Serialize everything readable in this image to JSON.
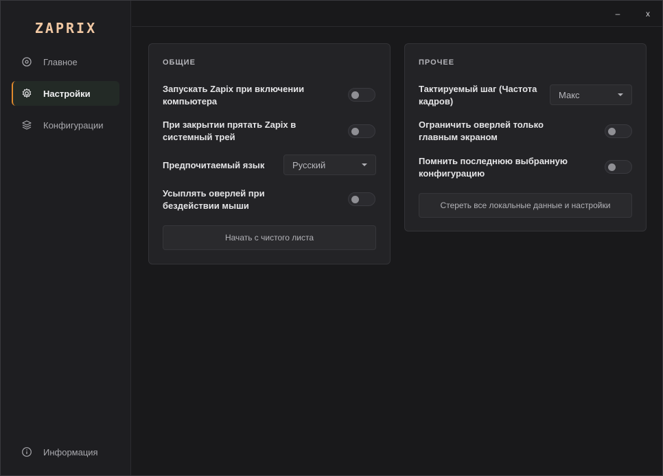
{
  "app": {
    "logo": "ZAPRIX"
  },
  "window_controls": {
    "minimize": "–",
    "close": "x"
  },
  "sidebar": {
    "items": [
      {
        "label": "Главное",
        "icon": "crosshair-icon"
      },
      {
        "label": "Настройки",
        "icon": "gear-icon",
        "active": true
      },
      {
        "label": "Конфигурации",
        "icon": "layers-icon"
      }
    ],
    "footer": {
      "label": "Информация",
      "icon": "info-icon"
    }
  },
  "general": {
    "title": "ОБЩИЕ",
    "autostart_label": "Запускать Zapix при включении компьютера",
    "autostart_on": false,
    "tray_label": "При закрытии прятать Zapix в системный трей",
    "tray_on": false,
    "language_label": "Предпочитаемый язык",
    "language_value": "Русский",
    "sleep_label": "Усыплять оверлей при бездействии мыши",
    "sleep_on": false,
    "reset_button": "Начать с чистого листа"
  },
  "other": {
    "title": "ПРОЧЕЕ",
    "tick_label": "Тактируемый шаг (Частота кадров)",
    "tick_value": "Макс",
    "main_screen_label": "Ограничить оверлей только главным экраном",
    "main_screen_on": false,
    "remember_label": "Помнить последнюю выбранную конфигурацию",
    "remember_on": false,
    "wipe_button": "Стереть все локальные данные и настройки"
  },
  "colors": {
    "accent": "#e08a2d",
    "logo": "#f2c9a4",
    "background": "#19191b",
    "panel": "#232326"
  }
}
